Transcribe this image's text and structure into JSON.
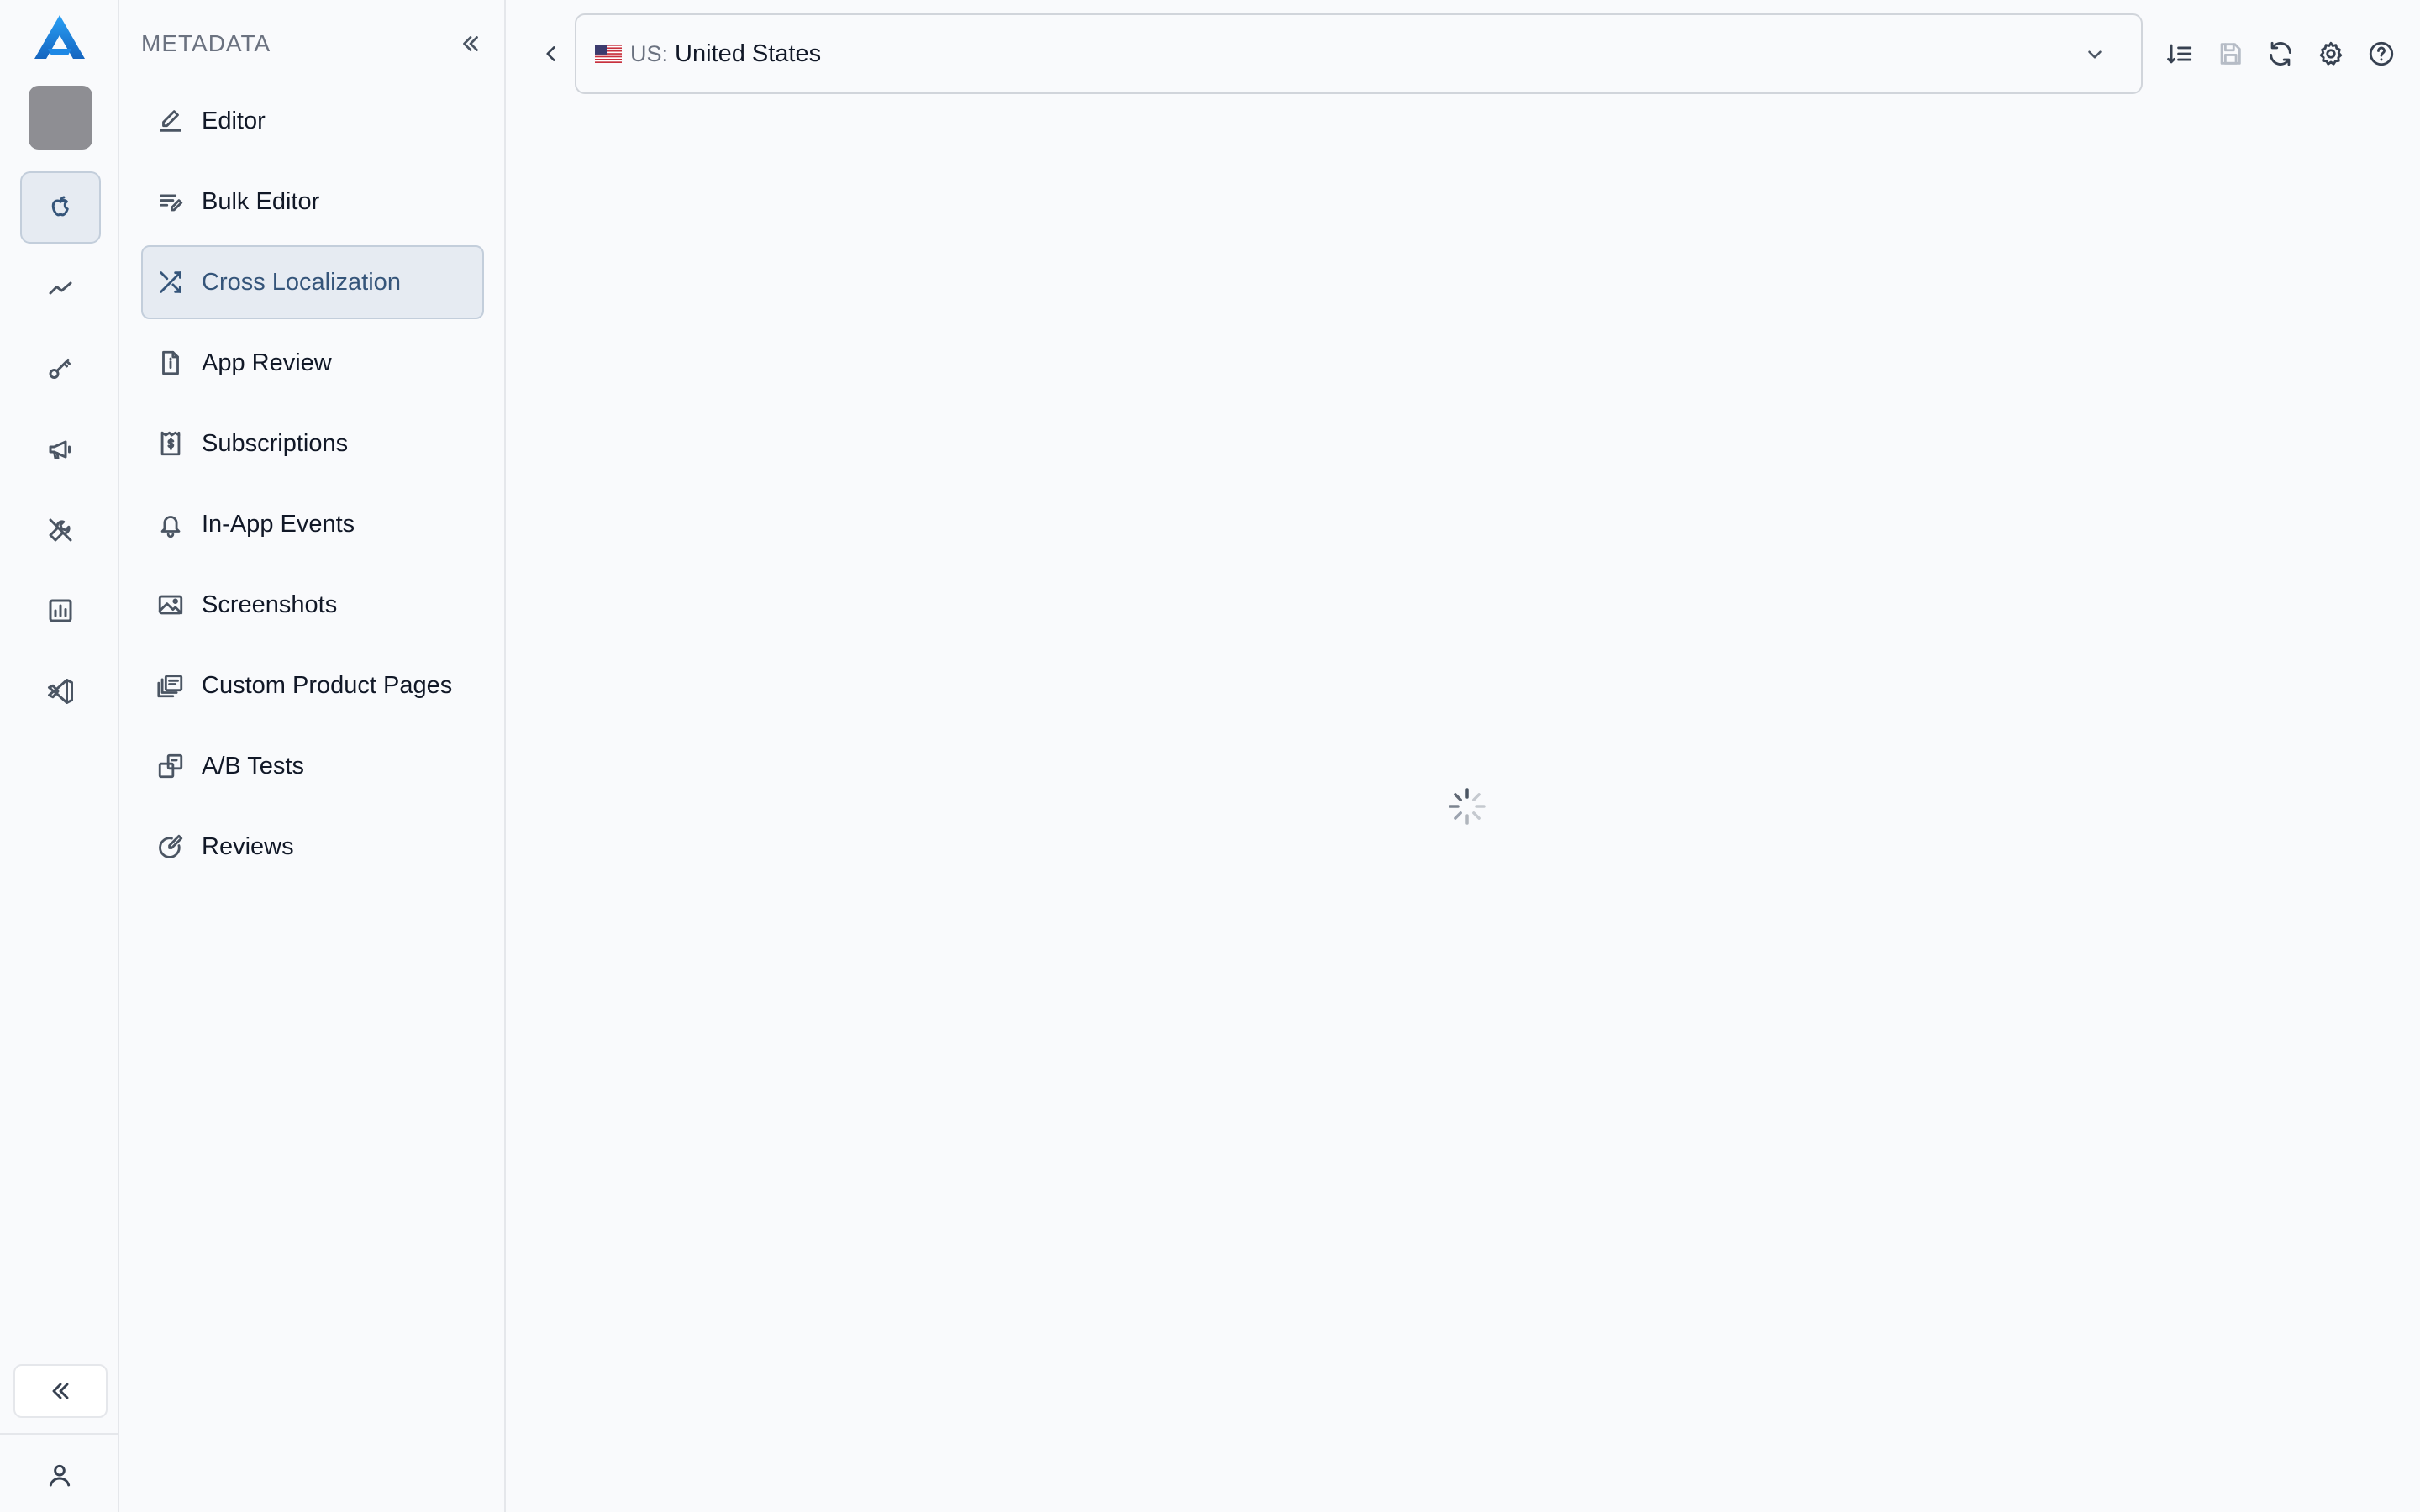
{
  "app": {
    "rail": {
      "items": [
        {
          "name": "apple-icon",
          "active": true
        },
        {
          "name": "trend-icon",
          "active": false
        },
        {
          "name": "key-icon",
          "active": false
        },
        {
          "name": "megaphone-icon",
          "active": false
        },
        {
          "name": "wrench-icon",
          "active": false
        },
        {
          "name": "bar-chart-icon",
          "active": false
        },
        {
          "name": "vscode-icon",
          "active": false
        }
      ]
    }
  },
  "sidebar": {
    "title": "METADATA",
    "items": [
      {
        "label": "Editor",
        "icon": "pencil-icon",
        "active": false
      },
      {
        "label": "Bulk Editor",
        "icon": "bulk-edit-icon",
        "active": false
      },
      {
        "label": "Cross Localization",
        "icon": "shuffle-icon",
        "active": true
      },
      {
        "label": "App Review",
        "icon": "document-info-icon",
        "active": false
      },
      {
        "label": "Subscriptions",
        "icon": "receipt-dollar-icon",
        "active": false
      },
      {
        "label": "In-App Events",
        "icon": "bell-icon",
        "active": false
      },
      {
        "label": "Screenshots",
        "icon": "image-icon",
        "active": false
      },
      {
        "label": "Custom Product Pages",
        "icon": "stacked-pages-icon",
        "active": false
      },
      {
        "label": "A/B Tests",
        "icon": "ab-squares-icon",
        "active": false
      },
      {
        "label": "Reviews",
        "icon": "review-edit-icon",
        "active": false
      }
    ]
  },
  "main": {
    "locale": {
      "code": "US:",
      "name": "United States",
      "flag": "us-flag-icon"
    },
    "toolbar": [
      "sort-list-icon",
      "save-icon",
      "refresh-icon",
      "gear-icon",
      "help-icon"
    ],
    "loading": true
  },
  "colors": {
    "background": "#f9fafc",
    "active_bg": "#e6ebf2",
    "active_text": "#35557a",
    "logo_blue": "#1e88e5"
  }
}
